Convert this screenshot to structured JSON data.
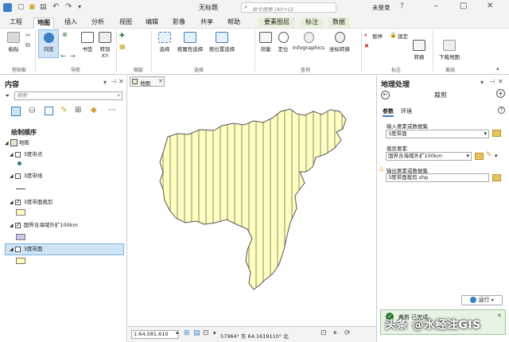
{
  "window": {
    "title": "无标题",
    "search_placeholder": "命令搜索 (Alt+Q)",
    "user": "未登录"
  },
  "menu": {
    "items": [
      "工程",
      "地图",
      "插入",
      "分析",
      "视图",
      "编辑",
      "影像",
      "共享",
      "帮助"
    ],
    "context_tab": "要素图层",
    "extra_tabs": [
      "标注",
      "数据"
    ],
    "active": "地图"
  },
  "ribbon": {
    "buttons": {
      "paste": "粘贴",
      "explore": "浏览",
      "bookmarks": "书签",
      "goto_xy": "转到 XY",
      "select": "选择",
      "select_by_attr": "按属性选择",
      "select_by_loc": "按位置选择",
      "measure": "测量",
      "locate": "定位",
      "infographics": "Infographics",
      "coord_convert": "坐标转换",
      "pause": "暂停",
      "lock": "锁定",
      "convert": "转换",
      "download_map": "下载地图"
    },
    "groups": {
      "clipboard": "剪贴板",
      "navigate": "导航",
      "layer": "图层",
      "selection": "选择",
      "inquiry": "查询",
      "labeling": "标注",
      "offline": "离线"
    }
  },
  "contents": {
    "title": "内容",
    "search_placeholder": "搜索",
    "drawing_order": "绘制顺序",
    "layers": [
      {
        "name": "地图",
        "checked": true,
        "symbol": "map"
      },
      {
        "name": "3度带点",
        "checked": false,
        "symbol": "point"
      },
      {
        "name": "3度带线",
        "checked": false,
        "symbol": "line"
      },
      {
        "name": "3度带面裁剪",
        "checked": true,
        "symbol": "poly-yellow"
      },
      {
        "name": "国界含海域外扩100km",
        "checked": true,
        "symbol": "poly-purple"
      },
      {
        "name": "3度带面",
        "checked": false,
        "symbol": "poly-yellow",
        "selected": true
      }
    ],
    "colors": {
      "poly_yellow": "#ffffc0",
      "poly_purple": "#c8c8f0",
      "selected_bg": "#cfe4f7"
    }
  },
  "map": {
    "tab": "地图",
    "scale": "1:64,581,610",
    "coords": "57964° 东 64.1619110° 北"
  },
  "geoprocessing": {
    "title": "地理处理",
    "tool": "裁剪",
    "tabs": [
      "参数",
      "环境"
    ],
    "input_label": "输入要素或数据集",
    "input_value": "3度带面",
    "clip_label": "裁剪要素",
    "clip_value": "国界含海域外扩100km",
    "output_label": "输出要素或数据集",
    "output_value": "3度带面裁剪.shp",
    "run": "运行",
    "status": "裁剪 已完成。"
  },
  "watermark": "头条 @水经注GIS"
}
